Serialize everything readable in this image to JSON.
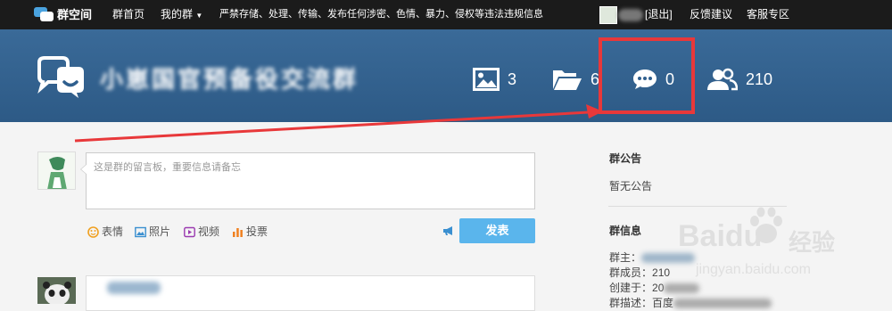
{
  "topbar": {
    "site_name": "群空间",
    "nav_home": "群首页",
    "nav_my_groups": "我的群",
    "notice": "严禁存储、处理、传输、发布任何涉密、色情、暴力、侵权等违法违规信息",
    "logout": "[退出]",
    "feedback": "反馈建议",
    "support": "客服专区"
  },
  "header": {
    "group_name": "小崽国官预备役交流群",
    "stats": {
      "photos": "3",
      "files": "6",
      "messages": "0",
      "members": "210"
    }
  },
  "compose": {
    "placeholder": "这是群的留言板，重要信息请备忘",
    "tools": {
      "emoji": "表情",
      "photo": "照片",
      "video": "视频",
      "vote": "投票"
    },
    "send": "发表"
  },
  "sidebar": {
    "announce_title": "群公告",
    "announce_text": "暂无公告",
    "info_title": "群信息",
    "owner_label": "群主：",
    "members_label": "群成员：",
    "members_value": "210",
    "created_label": "创建于：",
    "created_value": "20",
    "desc_label": "群描述：",
    "desc_value": "百度"
  },
  "watermark": {
    "brand": "Baidu",
    "brand_cn": "经验",
    "url": "jingyan.baidu.com"
  },
  "colors": {
    "topbar": "#1b1b1b",
    "banner": "#2f5f8e",
    "accent": "#5ab5ec",
    "highlight": "#e8383a"
  }
}
